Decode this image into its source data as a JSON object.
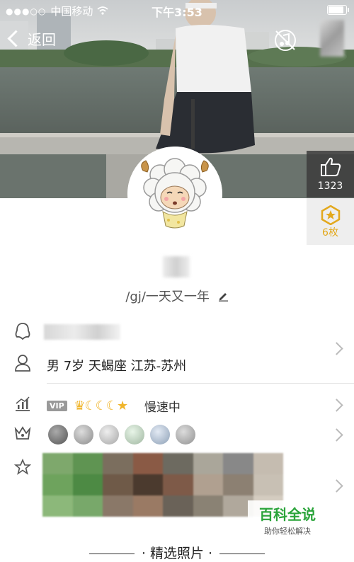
{
  "status_bar": {
    "signal_dots": "●●●○○",
    "carrier": "中国移动",
    "time": "下午3:53",
    "battery_level": 0.8
  },
  "header": {
    "back_label": "返回"
  },
  "profile": {
    "like_count": "1323",
    "medal_count": "6枚",
    "signature": "/gj/一天又一年"
  },
  "info": {
    "details": "男 7岁 天蝎座 江苏-苏州",
    "vip_tag": "VIP",
    "vip_level_icons": "♛☾☾☾★",
    "speed_status": "慢速中"
  },
  "watermark": {
    "title": "百科全说",
    "subtitle": "助你轻松解决"
  },
  "sections": {
    "featured_photos": "精选照片"
  },
  "colors": {
    "accent": "#e3a81c",
    "watermark_green": "#2aa43a"
  }
}
